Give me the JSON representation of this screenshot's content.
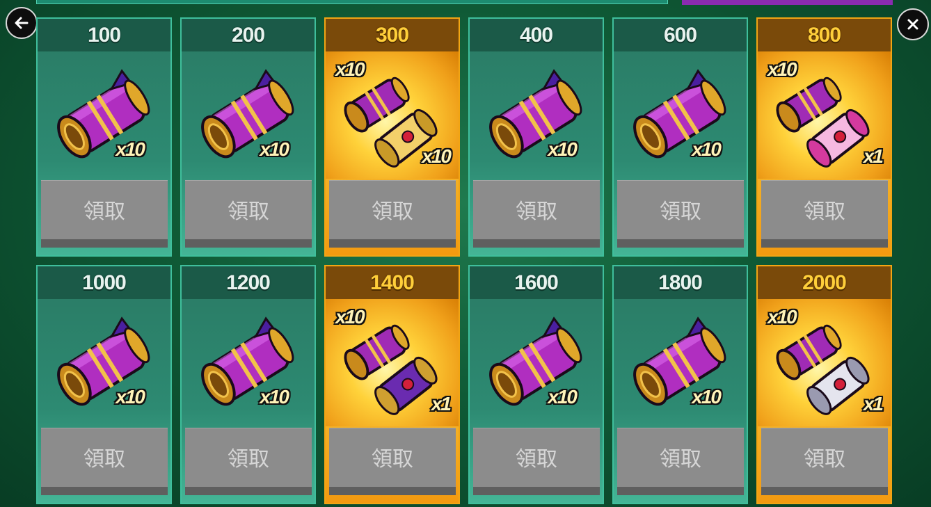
{
  "navigation": {
    "back_icon": "arrow-left-icon",
    "close_icon": "close-icon"
  },
  "colors": {
    "teal_card": "#2d8a72",
    "gold_card": "#f5b52a",
    "claim_button": "#8c8c8c"
  },
  "rewards": [
    {
      "threshold": "100",
      "quantity": "x10",
      "claim_label": "領取",
      "style": "teal",
      "art": "purple-scroll-icon"
    },
    {
      "threshold": "200",
      "quantity": "x10",
      "claim_label": "領取",
      "style": "teal",
      "art": "purple-scroll-icon"
    },
    {
      "threshold": "300",
      "quantity": "x10",
      "bonus_quantity": "x10",
      "claim_label": "領取",
      "style": "gold",
      "art": "gold-scroll-icon"
    },
    {
      "threshold": "400",
      "quantity": "x10",
      "claim_label": "領取",
      "style": "teal",
      "art": "purple-scroll-icon"
    },
    {
      "threshold": "600",
      "quantity": "x10",
      "claim_label": "領取",
      "style": "teal",
      "art": "purple-scroll-icon"
    },
    {
      "threshold": "800",
      "quantity": "x1",
      "bonus_quantity": "x10",
      "claim_label": "領取",
      "style": "gold",
      "art": "pink-scroll-icon"
    },
    {
      "threshold": "1000",
      "quantity": "x10",
      "claim_label": "領取",
      "style": "teal",
      "art": "purple-scroll-icon"
    },
    {
      "threshold": "1200",
      "quantity": "x10",
      "claim_label": "領取",
      "style": "teal",
      "art": "purple-scroll-icon"
    },
    {
      "threshold": "1400",
      "quantity": "x1",
      "bonus_quantity": "x10",
      "claim_label": "領取",
      "style": "gold",
      "art": "violet-scroll-icon"
    },
    {
      "threshold": "1600",
      "quantity": "x10",
      "claim_label": "領取",
      "style": "teal",
      "art": "purple-scroll-icon"
    },
    {
      "threshold": "1800",
      "quantity": "x10",
      "claim_label": "領取",
      "style": "teal",
      "art": "purple-scroll-icon"
    },
    {
      "threshold": "2000",
      "quantity": "x1",
      "bonus_quantity": "x10",
      "claim_label": "領取",
      "style": "gold",
      "art": "silver-scroll-icon"
    }
  ]
}
